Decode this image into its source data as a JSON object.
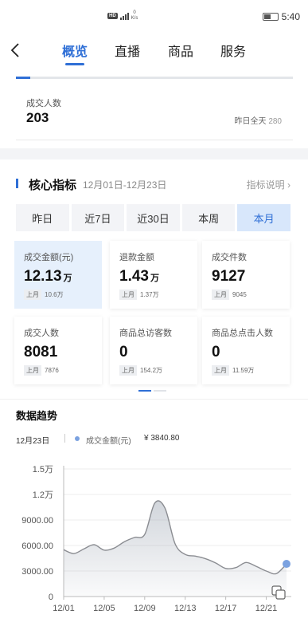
{
  "status": {
    "hd": "HD",
    "net_speed": "0",
    "net_unit": "K/s",
    "time": "5:40"
  },
  "nav": {
    "tabs": [
      "概览",
      "直播",
      "商品",
      "服务"
    ],
    "active": 0
  },
  "top_card": {
    "label": "成交人数",
    "value": "203",
    "yesterday_label": "昨日全天",
    "yesterday_value": "280"
  },
  "core": {
    "title": "核心指标",
    "range": "12月01日-12月23日",
    "help": "指标说明",
    "periods": [
      "昨日",
      "近7日",
      "近30日",
      "本周",
      "本月"
    ],
    "active_period": 4,
    "metrics": [
      {
        "label": "成交金额(元)",
        "value": "12.13",
        "unit": "万",
        "prev_label": "上月",
        "prev_value": "10.6万"
      },
      {
        "label": "退款金额",
        "value": "1.43",
        "unit": "万",
        "prev_label": "上月",
        "prev_value": "1.37万"
      },
      {
        "label": "成交件数",
        "value": "9127",
        "unit": "",
        "prev_label": "上月",
        "prev_value": "9045"
      },
      {
        "label": "成交人数",
        "value": "8081",
        "unit": "",
        "prev_label": "上月",
        "prev_value": "7876"
      },
      {
        "label": "商品总访客数",
        "value": "0",
        "unit": "",
        "prev_label": "上月",
        "prev_value": "154.2万"
      },
      {
        "label": "商品总点击人数",
        "value": "0",
        "unit": "",
        "prev_label": "上月",
        "prev_value": "11.59万"
      }
    ]
  },
  "trend": {
    "title": "数据趋势",
    "date": "12月23日",
    "legend": "成交金额(元)",
    "value": "¥ 3840.80"
  },
  "colors": {
    "accent": "#2f6fd6",
    "line": "#8b8d92",
    "highlight": "#7ba2e0"
  },
  "chart_data": {
    "type": "area",
    "x": [
      "12/01",
      "12/02",
      "12/03",
      "12/04",
      "12/05",
      "12/06",
      "12/07",
      "12/08",
      "12/09",
      "12/10",
      "12/11",
      "12/12",
      "12/13",
      "12/14",
      "12/15",
      "12/16",
      "12/17",
      "12/18",
      "12/19",
      "12/20",
      "12/21",
      "12/22",
      "12/23"
    ],
    "series": [
      {
        "name": "成交金额(元)",
        "values": [
          5500,
          5050,
          5600,
          6100,
          5450,
          5700,
          6450,
          6950,
          7300,
          11000,
          10400,
          6200,
          4950,
          4750,
          4450,
          3950,
          3300,
          3400,
          4000,
          3550,
          3000,
          2700,
          3840.8
        ]
      }
    ],
    "x_tick_labels": [
      "12/01",
      "12/05",
      "12/09",
      "12/13",
      "12/17",
      "12/21"
    ],
    "y_tick_labels": [
      "0",
      "3000.00",
      "6000.00",
      "9000.00",
      "1.2万",
      "1.5万"
    ],
    "y_ticks": [
      0,
      3000,
      6000,
      9000,
      12000,
      15000
    ],
    "ylim": [
      0,
      15000
    ],
    "grid": true,
    "highlight_index": 22
  }
}
